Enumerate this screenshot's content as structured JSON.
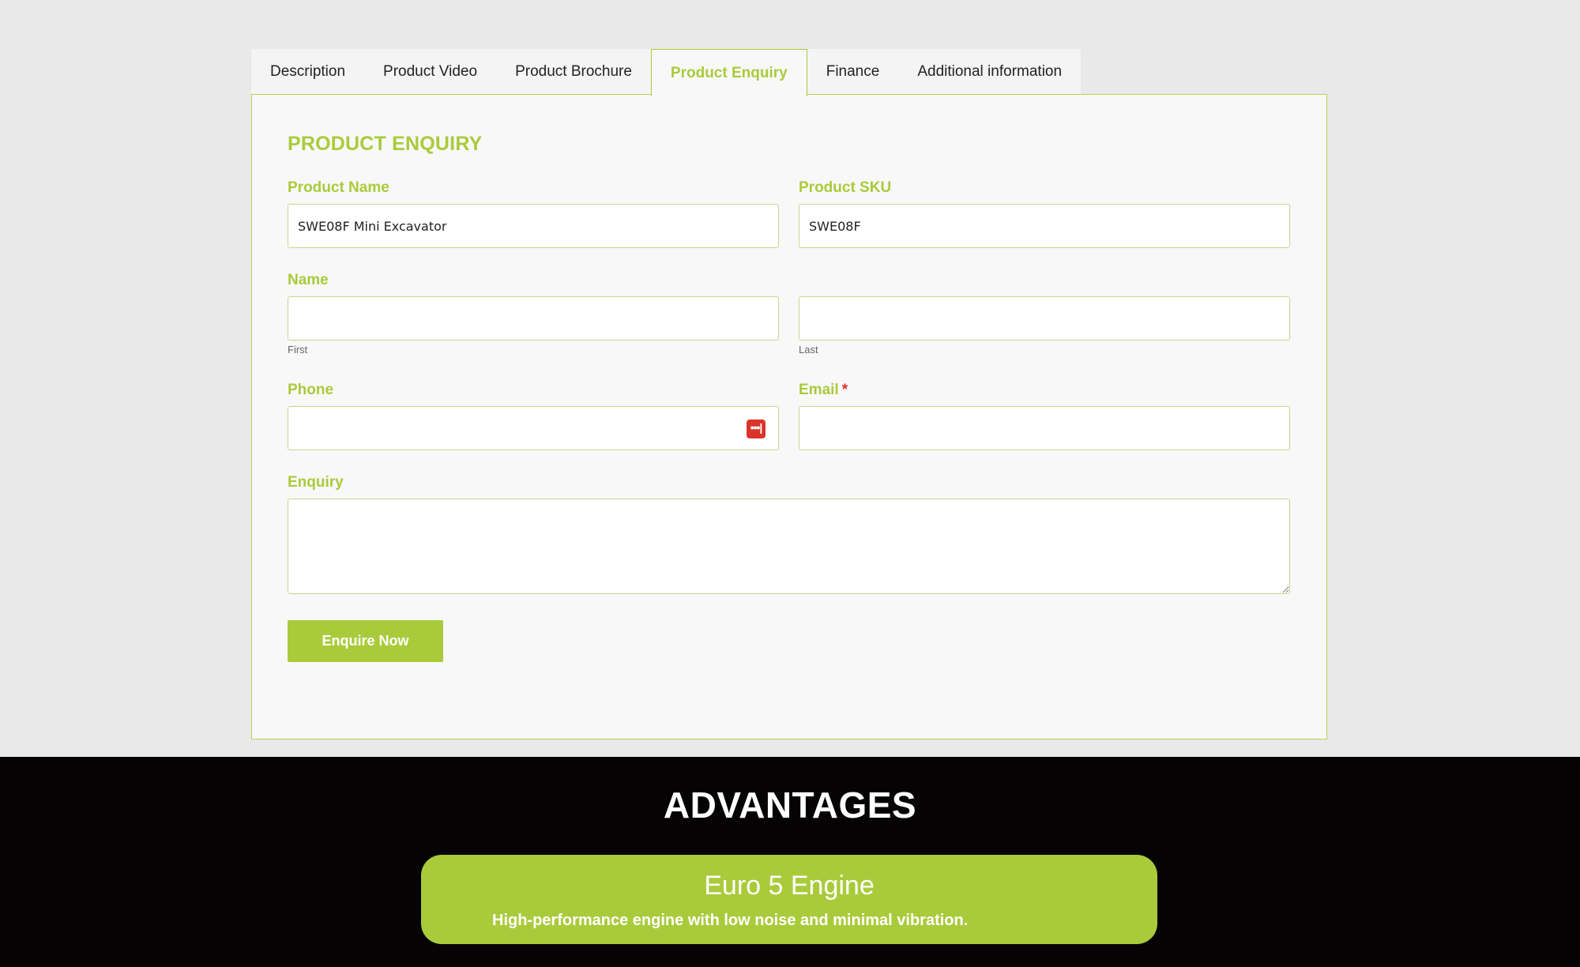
{
  "tabs": [
    {
      "label": "Description"
    },
    {
      "label": "Product Video"
    },
    {
      "label": "Product Brochure"
    },
    {
      "label": "Product Enquiry"
    },
    {
      "label": "Finance"
    },
    {
      "label": "Additional information"
    }
  ],
  "form": {
    "title": "PRODUCT ENQUIRY",
    "product_name": {
      "label": "Product Name",
      "value": "SWE08F Mini Excavator"
    },
    "product_sku": {
      "label": "Product SKU",
      "value": "SWE08F"
    },
    "name": {
      "label": "Name",
      "first_hint": "First",
      "last_hint": "Last",
      "first_value": "",
      "last_value": ""
    },
    "phone": {
      "label": "Phone",
      "value": ""
    },
    "email": {
      "label": "Email",
      "required_mark": "*",
      "value": ""
    },
    "enquiry": {
      "label": "Enquiry",
      "value": ""
    },
    "submit_label": "Enquire Now",
    "password_icon_glyph": "•••|"
  },
  "advantages": {
    "title": "ADVANTAGES",
    "card": {
      "title": "Euro 5 Engine",
      "description": "High-performance engine with low noise and minimal vibration."
    }
  },
  "colors": {
    "accent": "#a9cb3b",
    "required": "#d93025",
    "dark_section": "#060304"
  }
}
